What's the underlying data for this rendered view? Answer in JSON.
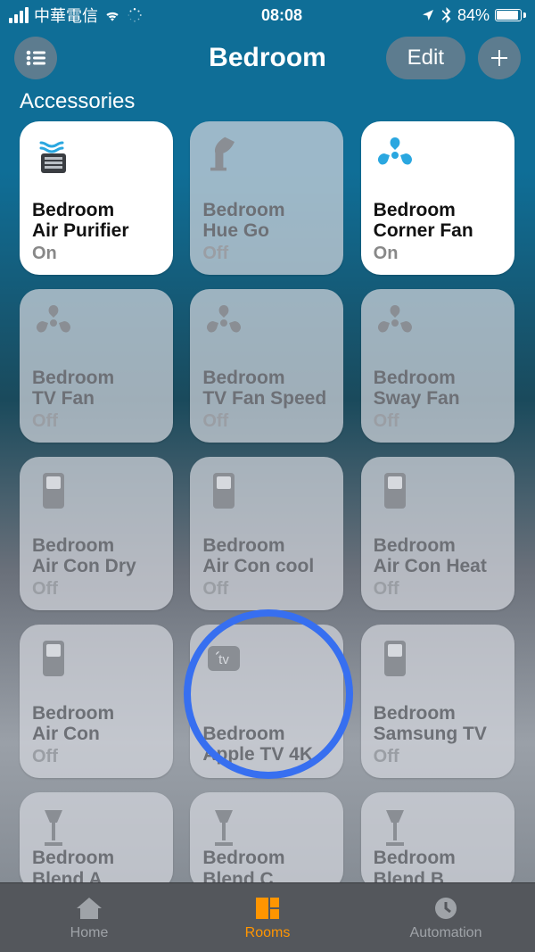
{
  "statusbar": {
    "carrier": "中華電信",
    "time": "08:08",
    "battery_pct": "84%"
  },
  "nav": {
    "title": "Bedroom",
    "edit": "Edit"
  },
  "section": {
    "title": "Accessories"
  },
  "tiles": [
    {
      "room": "Bedroom",
      "name": "Air Purifier",
      "state": "On",
      "on": true,
      "icon": "purifier"
    },
    {
      "room": "Bedroom",
      "name": "Hue Go",
      "state": "Off",
      "on": false,
      "icon": "lamp"
    },
    {
      "room": "Bedroom",
      "name": "Corner Fan",
      "state": "On",
      "on": true,
      "icon": "fan"
    },
    {
      "room": "Bedroom",
      "name": "TV Fan",
      "state": "Off",
      "on": false,
      "icon": "fan"
    },
    {
      "room": "Bedroom",
      "name": "TV Fan Speed",
      "state": "Off",
      "on": false,
      "icon": "fan"
    },
    {
      "room": "Bedroom",
      "name": "Sway Fan",
      "state": "Off",
      "on": false,
      "icon": "fan"
    },
    {
      "room": "Bedroom",
      "name": "Air Con Dry",
      "state": "Off",
      "on": false,
      "icon": "switch"
    },
    {
      "room": "Bedroom",
      "name": "Air Con cool",
      "state": "Off",
      "on": false,
      "icon": "switch"
    },
    {
      "room": "Bedroom",
      "name": "Air Con Heat",
      "state": "Off",
      "on": false,
      "icon": "switch"
    },
    {
      "room": "Bedroom",
      "name": "Air Con",
      "state": "Off",
      "on": false,
      "icon": "switch"
    },
    {
      "room": "Bedroom",
      "name": "Apple TV 4K",
      "state": "",
      "on": false,
      "icon": "appletv"
    },
    {
      "room": "Bedroom",
      "name": "Samsung TV",
      "state": "Off",
      "on": false,
      "icon": "switch"
    },
    {
      "room": "Bedroom",
      "name": "Blend A",
      "state": "",
      "on": false,
      "icon": "floorlamp"
    },
    {
      "room": "Bedroom",
      "name": "Blend C",
      "state": "",
      "on": false,
      "icon": "floorlamp"
    },
    {
      "room": "Bedroom",
      "name": "Blend B",
      "state": "",
      "on": false,
      "icon": "floorlamp"
    }
  ],
  "tabs": {
    "home": "Home",
    "rooms": "Rooms",
    "automation": "Automation",
    "active": "rooms"
  },
  "highlight_tile_index": 10
}
